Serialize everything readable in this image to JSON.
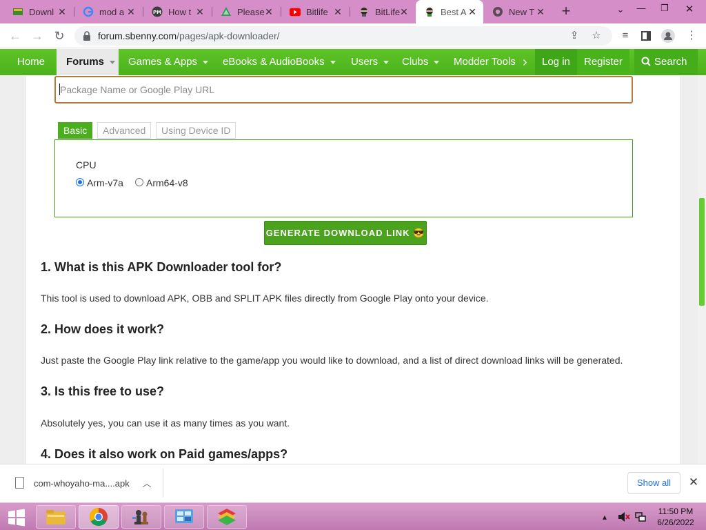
{
  "tabs": [
    {
      "label": "Downl",
      "icon": "book-icon"
    },
    {
      "label": "mod a",
      "icon": "google-icon"
    },
    {
      "label": "How t",
      "icon": "pm-site-icon"
    },
    {
      "label": "Please",
      "icon": "triangle-site-icon"
    },
    {
      "label": "Bitlife",
      "icon": "youtube-icon"
    },
    {
      "label": "BitLife",
      "icon": "ninja-icon"
    },
    {
      "label": "Best A",
      "icon": "ninja-icon"
    },
    {
      "label": "New T",
      "icon": "chrome-icon"
    }
  ],
  "address": {
    "domain": "forum.sbenny.com",
    "path": "/pages/apk-downloader/"
  },
  "sitenav": {
    "home": "Home",
    "forums": "Forums",
    "games": "Games & Apps",
    "ebooks": "eBooks & AudioBooks",
    "users": "Users",
    "clubs": "Clubs",
    "modder": "Modder Tools",
    "login": "Log in",
    "register": "Register",
    "search": "Search"
  },
  "form": {
    "placeholder": "Package Name or Google Play URL",
    "tabs": {
      "basic": "Basic",
      "advanced": "Advanced",
      "device": "Using Device ID"
    },
    "cpu_label": "CPU",
    "cpu_options": [
      "Arm-v7a",
      "Arm64-v8"
    ],
    "cpu_selected": "Arm-v7a",
    "generate_label": "GENERATE DOWNLOAD LINK 😎"
  },
  "faq": [
    {
      "q": "1. What is this APK Downloader tool for?",
      "a": "This tool is used to download APK, OBB and SPLIT APK files directly from Google Play onto your device."
    },
    {
      "q": "2. How does it work?",
      "a": "Just paste the Google Play link relative to the game/app you would like to download, and a list of direct download links will be generated."
    },
    {
      "q": "3. Is this free to use?",
      "a": "Absolutely yes, you can use it as many times as you want."
    },
    {
      "q": "4. Does it also work on Paid games/apps?",
      "a": ""
    }
  ],
  "downloads": {
    "filename": "com-whoyaho-ma....apk",
    "show_all": "Show all"
  },
  "clock": {
    "time": "11:50 PM",
    "date": "6/26/2022"
  },
  "colors": {
    "site_green": "#52c41a",
    "tabstrip": "#d58ec7",
    "input_border": "#b07d3a"
  }
}
